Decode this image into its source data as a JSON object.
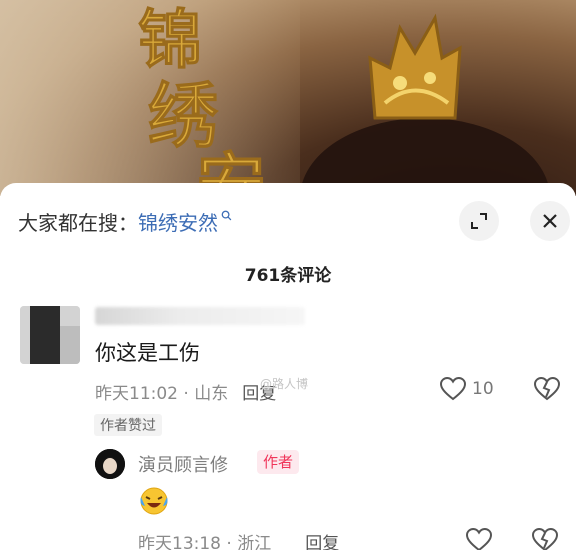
{
  "banner": {
    "title_calligraphy": "锦绣安"
  },
  "search": {
    "prefix": "大家都在搜：",
    "term": "锦绣安然"
  },
  "comments": {
    "count_title": "761条评论"
  },
  "comment": {
    "text": "你这是工伤",
    "time": "昨天11:02 · 山东",
    "reply_label": "回复",
    "like_count": "10",
    "author_liked_badge": "作者赞过",
    "watermark": "@路人博"
  },
  "reply": {
    "author_name": "演员顾言修",
    "author_tag": "作者",
    "emoji": "laughing-crying-emoji",
    "time": "昨天13:18 · 浙江",
    "reply_label": "回复"
  },
  "icons": {
    "search": "search-icon",
    "expand": "expand-icon",
    "close": "close-icon",
    "like": "heart-icon",
    "dislike": "broken-heart-icon"
  },
  "colors": {
    "link_blue": "#3d6db5",
    "author_tag_red": "#f0355a",
    "gold": "#d9a93a"
  }
}
